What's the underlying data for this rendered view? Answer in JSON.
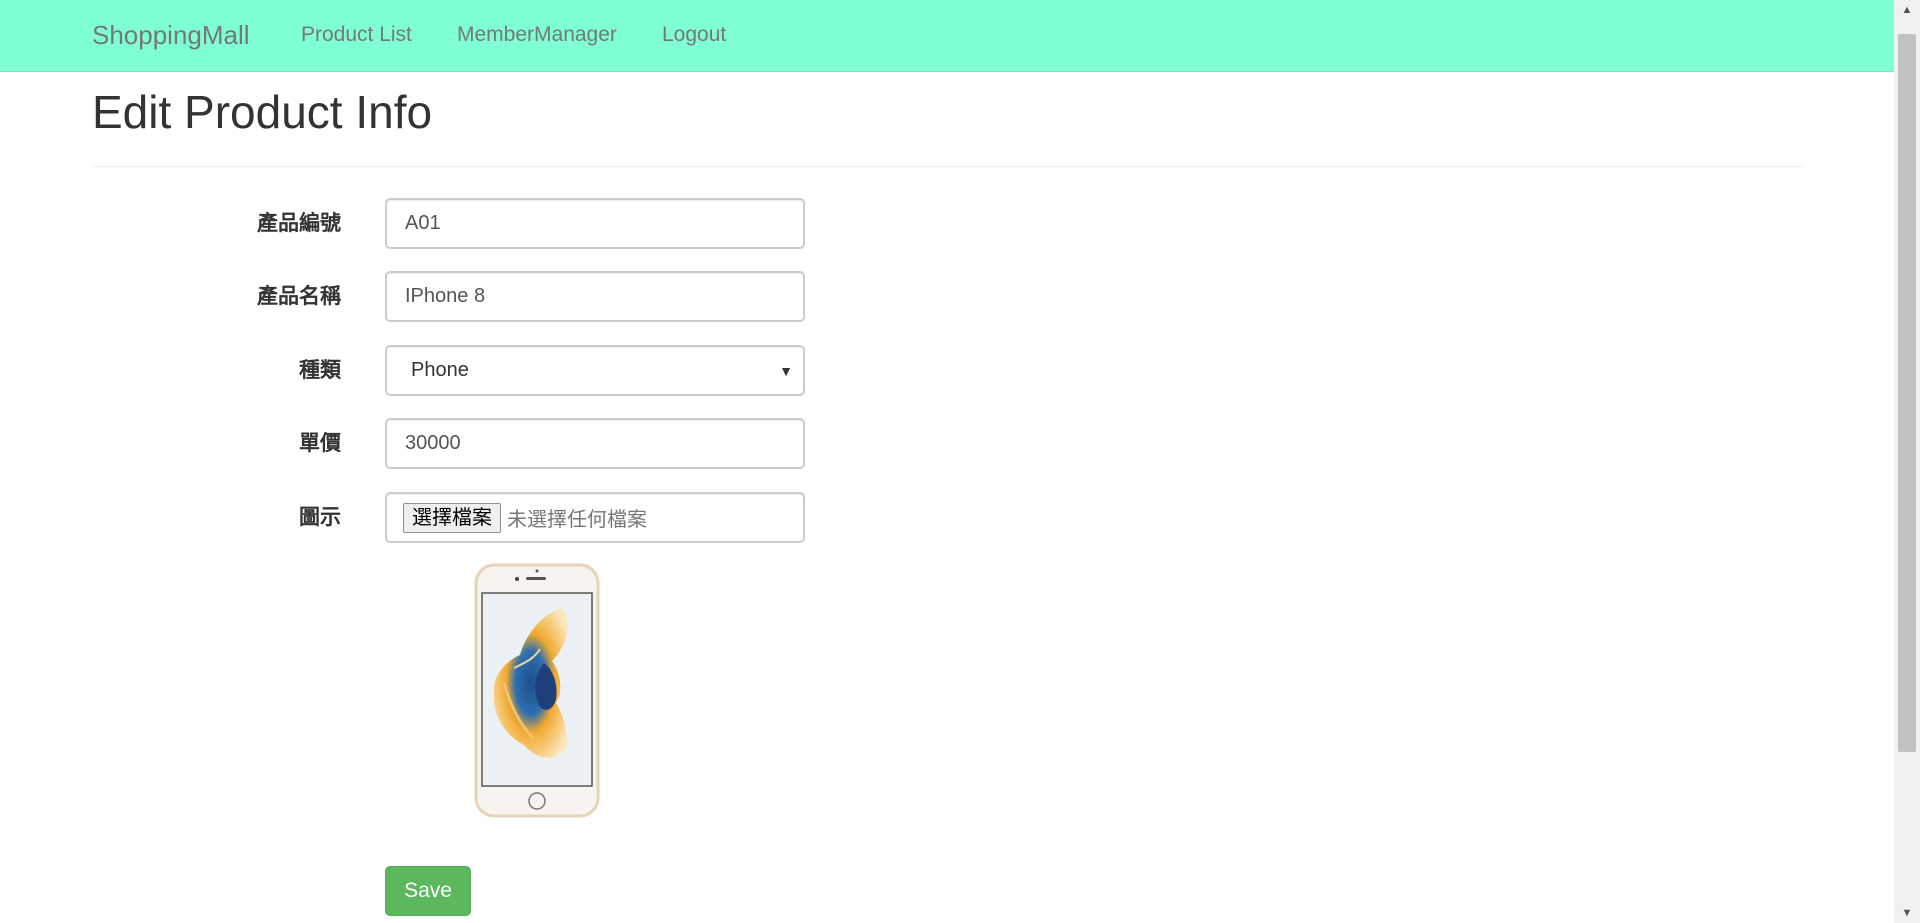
{
  "navbar": {
    "brand": "ShoppingMall",
    "links": [
      "Product List",
      "MemberManager",
      "Logout"
    ],
    "background": "#7fffd4"
  },
  "page": {
    "title": "Edit Product Info"
  },
  "form": {
    "product_id": {
      "label": "產品編號",
      "value": "A01"
    },
    "product_name": {
      "label": "產品名稱",
      "value": "IPhone 8"
    },
    "category": {
      "label": "種類",
      "selected": "Phone"
    },
    "price": {
      "label": "單價",
      "value": "30000"
    },
    "image": {
      "label": "圖示",
      "button_label": "選擇檔案",
      "status": "未選擇任何檔案"
    }
  },
  "save_label": "Save",
  "colors": {
    "save_button": "#5cb85c",
    "phone_frame": "#e8d3b8"
  },
  "icons": {
    "select_arrow": "chevron-down-icon",
    "scroll_up": "scroll-up-arrow-icon",
    "scroll_down": "scroll-down-arrow-icon"
  }
}
